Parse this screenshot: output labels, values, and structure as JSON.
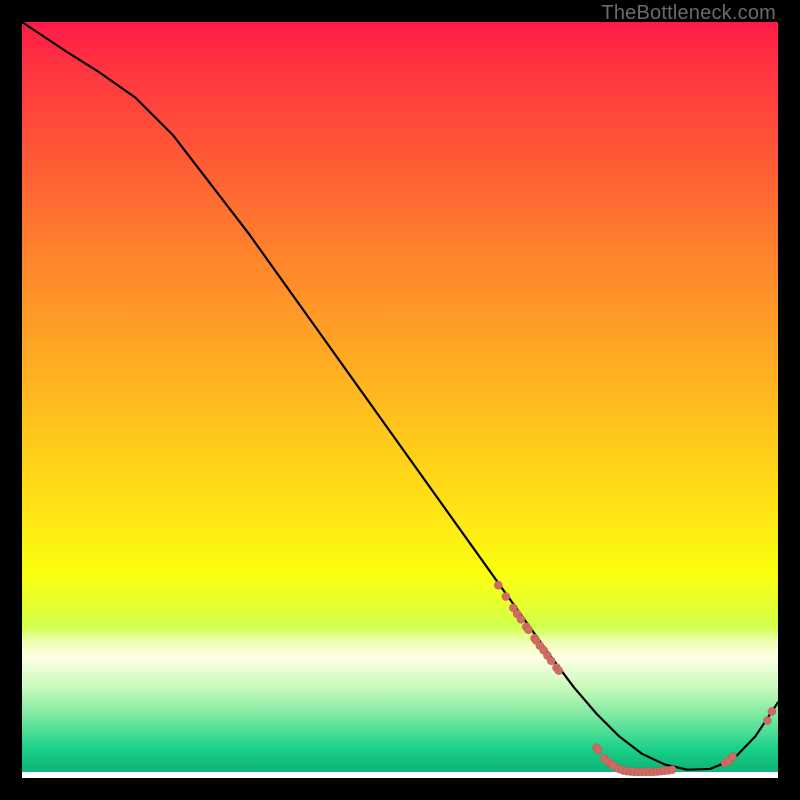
{
  "watermark": "TheBottleneck.com",
  "colors": {
    "dot": "#cf6b63",
    "curve": "#000000",
    "frame_bg_top": "#ff1a49",
    "frame_bg_bottom": "#0fb97a",
    "page_bg": "#000000"
  },
  "chart_data": {
    "type": "line",
    "title": "",
    "xlabel": "",
    "ylabel": "",
    "xlim": [
      0,
      100
    ],
    "ylim": [
      0,
      100
    ],
    "series": [
      {
        "name": "curve",
        "x": [
          0,
          3,
          6,
          10,
          15,
          20,
          25,
          30,
          35,
          40,
          45,
          50,
          55,
          60,
          65,
          70,
          73,
          76,
          79,
          82,
          85,
          88,
          91,
          94,
          97,
          100
        ],
        "y": [
          100,
          98,
          96,
          93.5,
          90,
          85,
          78.5,
          72,
          65,
          58,
          51,
          44,
          37,
          30,
          23,
          16,
          12,
          8.5,
          5.5,
          3.2,
          1.8,
          1.1,
          1.2,
          2.4,
          5.5,
          10
        ]
      }
    ],
    "scatter": [
      {
        "name": "dots",
        "points": [
          {
            "x": 63,
            "y": 25.5
          },
          {
            "x": 64,
            "y": 24
          },
          {
            "x": 65,
            "y": 22.5
          },
          {
            "x": 65.5,
            "y": 21.7
          },
          {
            "x": 66,
            "y": 21
          },
          {
            "x": 66.7,
            "y": 20
          },
          {
            "x": 67,
            "y": 19.6
          },
          {
            "x": 67.8,
            "y": 18.5
          },
          {
            "x": 68,
            "y": 18.2
          },
          {
            "x": 68.5,
            "y": 17.5
          },
          {
            "x": 69,
            "y": 16.9
          },
          {
            "x": 69.5,
            "y": 16.2
          },
          {
            "x": 70,
            "y": 15.5
          },
          {
            "x": 70.7,
            "y": 14.6
          },
          {
            "x": 71,
            "y": 14.2
          },
          {
            "x": 76,
            "y": 4.0
          },
          {
            "x": 76.2,
            "y": 3.7
          },
          {
            "x": 77,
            "y": 2.6
          },
          {
            "x": 77.5,
            "y": 2.2
          },
          {
            "x": 78,
            "y": 1.8
          },
          {
            "x": 78.2,
            "y": 1.6
          },
          {
            "x": 79,
            "y": 1.2
          },
          {
            "x": 79.5,
            "y": 1.0
          },
          {
            "x": 80,
            "y": 0.9
          },
          {
            "x": 80.5,
            "y": 0.85
          },
          {
            "x": 81,
            "y": 0.8
          },
          {
            "x": 81.5,
            "y": 0.8
          },
          {
            "x": 82,
            "y": 0.8
          },
          {
            "x": 82.5,
            "y": 0.8
          },
          {
            "x": 83,
            "y": 0.8
          },
          {
            "x": 83.5,
            "y": 0.8
          },
          {
            "x": 84,
            "y": 0.85
          },
          {
            "x": 84.5,
            "y": 0.9
          },
          {
            "x": 85,
            "y": 0.95
          },
          {
            "x": 85.5,
            "y": 1.0
          },
          {
            "x": 86,
            "y": 1.1
          },
          {
            "x": 93,
            "y": 2.0
          },
          {
            "x": 93.5,
            "y": 2.3
          },
          {
            "x": 94,
            "y": 2.8
          },
          {
            "x": 98.6,
            "y": 7.6
          },
          {
            "x": 99.2,
            "y": 8.8
          }
        ]
      }
    ]
  }
}
